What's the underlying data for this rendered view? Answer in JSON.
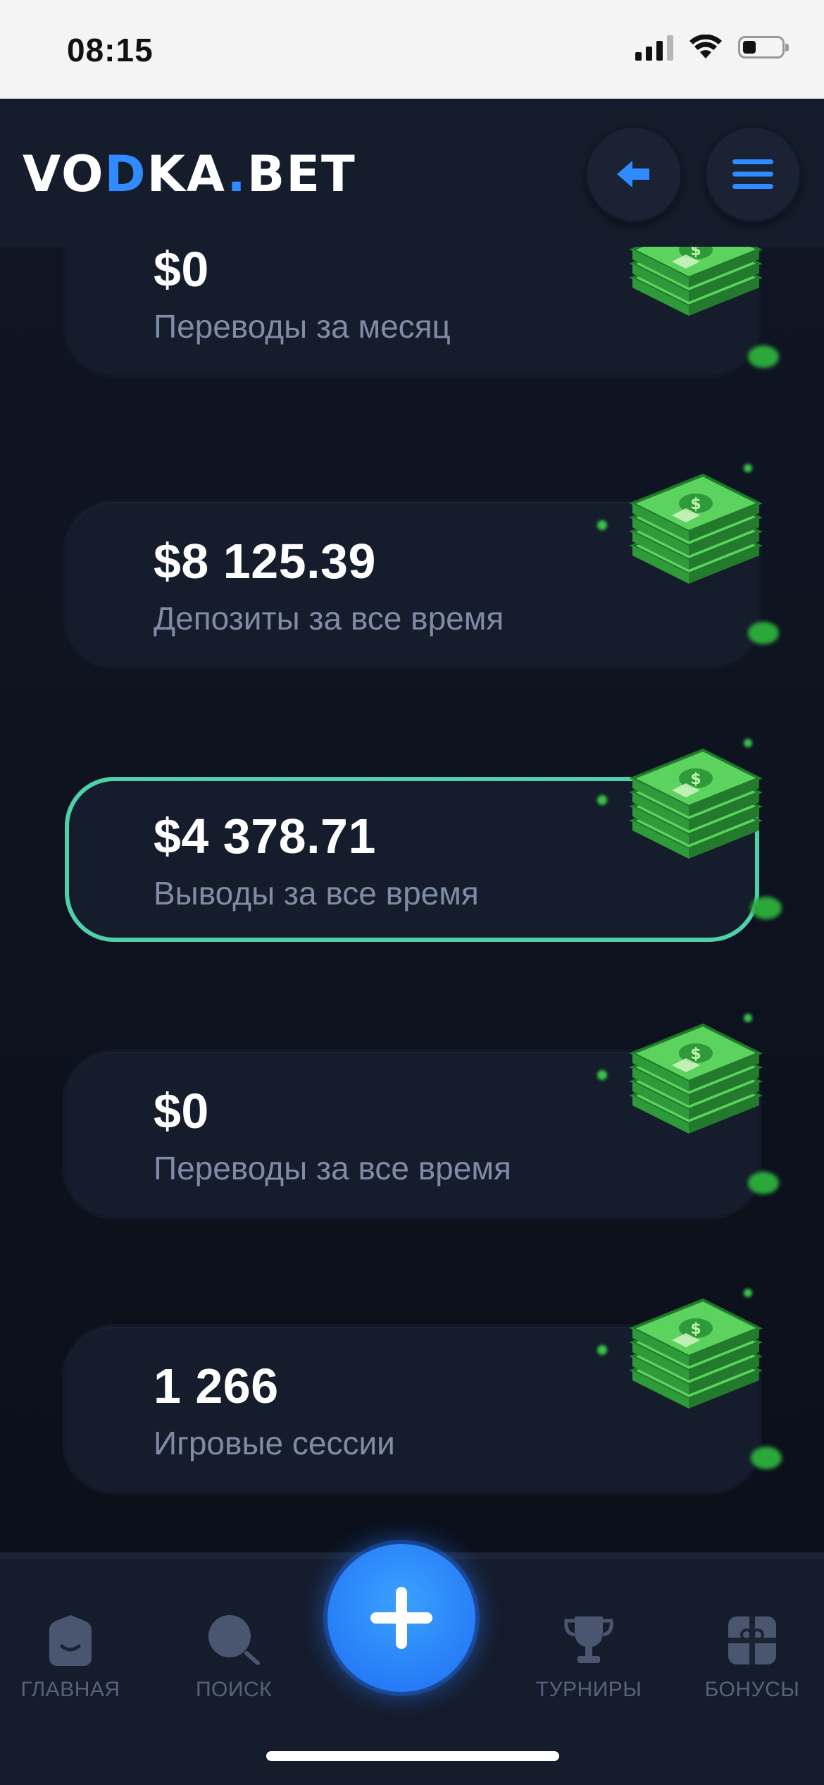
{
  "status_bar": {
    "time": "08:15"
  },
  "header": {
    "logo_part1": "VO",
    "logo_part2": "D",
    "logo_part3": "KA",
    "logo_dot": ".",
    "logo_part4": "BET"
  },
  "stats": [
    {
      "value": "$0",
      "label": "Переводы за месяц"
    },
    {
      "value": "$8 125.39",
      "label": "Депозиты за все время"
    },
    {
      "value": "$4 378.71",
      "label": "Выводы за все время"
    },
    {
      "value": "$0",
      "label": "Переводы за все время"
    },
    {
      "value": "1 266",
      "label": "Игровые сессии"
    }
  ],
  "bottom_nav": {
    "items": [
      {
        "label": "ГЛАВНАЯ",
        "icon": "home-icon"
      },
      {
        "label": "ПОИСК",
        "icon": "search-icon"
      },
      {
        "label": "ТУРНИРЫ",
        "icon": "trophy-icon"
      },
      {
        "label": "БОНУСЫ",
        "icon": "gift-icon"
      }
    ],
    "center_action_icon": "plus-icon"
  },
  "colors": {
    "accent_blue": "#2f8bff",
    "active_border": "#4fd1a8",
    "card_bg": "#151c2b",
    "label_gray": "#7f8ca6"
  }
}
